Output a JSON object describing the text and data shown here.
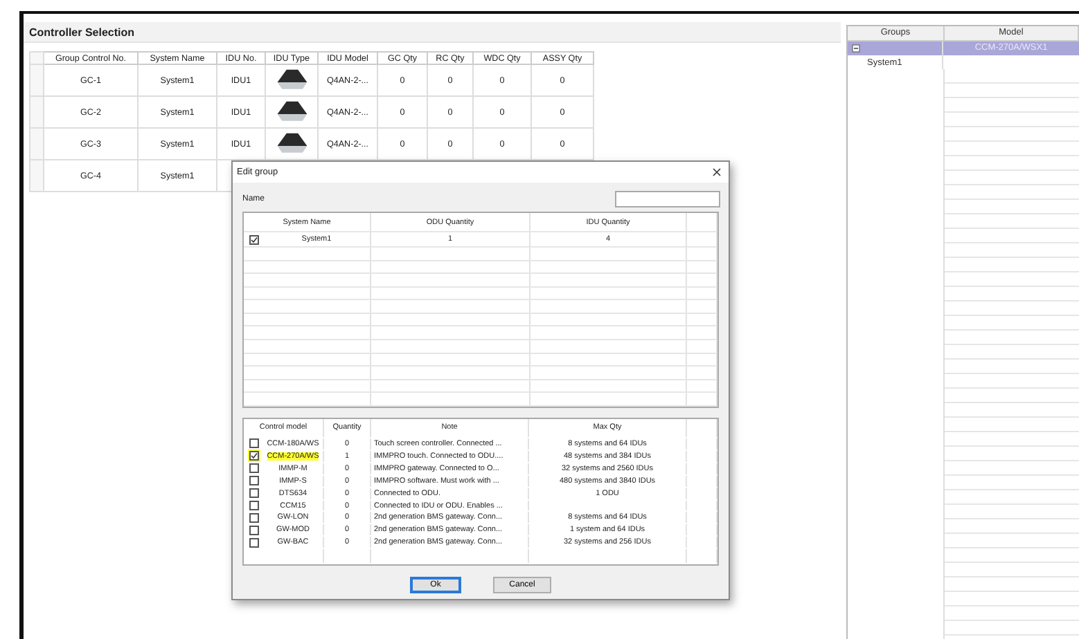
{
  "panel_title": "Controller Selection",
  "table": {
    "columns": [
      "Group Control No.",
      "System Name",
      "IDU No.",
      "IDU Type",
      "IDU Model",
      "GC Qty",
      "RC Qty",
      "WDC Qty",
      "ASSY Qty"
    ],
    "rows": [
      {
        "group_control_no": "GC-1",
        "system_name": "System1",
        "idu_no": "IDU1",
        "idu_model": "Q4AN-2-...",
        "gc_qty": "0",
        "rc_qty": "0",
        "wdc_qty": "0",
        "assy_qty": "0"
      },
      {
        "group_control_no": "GC-2",
        "system_name": "System1",
        "idu_no": "IDU1",
        "idu_model": "Q4AN-2-...",
        "gc_qty": "0",
        "rc_qty": "0",
        "wdc_qty": "0",
        "assy_qty": "0"
      },
      {
        "group_control_no": "GC-3",
        "system_name": "System1",
        "idu_no": "IDU1",
        "idu_model": "Q4AN-2-...",
        "gc_qty": "0",
        "rc_qty": "0",
        "wdc_qty": "0",
        "assy_qty": "0"
      },
      {
        "group_control_no": "GC-4",
        "system_name": "System1"
      }
    ]
  },
  "groups_panel": {
    "columns": [
      "Groups",
      "Model"
    ],
    "tree": [
      {
        "expanded": true,
        "selected": true,
        "model": "CCM-270A/WSX1",
        "children": [
          {
            "label": "System1"
          }
        ]
      }
    ]
  },
  "dialog": {
    "title": "Edit group",
    "name_label": "Name",
    "systems": {
      "columns": [
        "System Name",
        "ODU Quantity",
        "IDU Quantity"
      ],
      "rows": [
        {
          "checked": true,
          "system_name": "System1",
          "odu_quantity": "1",
          "idu_quantity": "4"
        }
      ]
    },
    "controls": {
      "columns": [
        "Control model",
        "Quantity",
        "Note",
        "Max Qty"
      ],
      "rows": [
        {
          "checked": false,
          "model": "CCM-180A/WS",
          "quantity": "0",
          "note": "Touch screen controller. Connected ...",
          "max_qty": "8 systems and 64 IDUs"
        },
        {
          "checked": true,
          "model": "CCM-270A/WS",
          "quantity": "1",
          "note": "IMMPRO touch. Connected to ODU....",
          "max_qty": "48 systems and 384 IDUs"
        },
        {
          "checked": false,
          "model": "IMMP-M",
          "quantity": "0",
          "note": "IMMPRO gateway. Connected to O...",
          "max_qty": "32 systems and 2560 IDUs"
        },
        {
          "checked": false,
          "model": "IMMP-S",
          "quantity": "0",
          "note": "IMMPRO software. Must work with ...",
          "max_qty": "480 systems and 3840 IDUs"
        },
        {
          "checked": false,
          "model": "DTS634",
          "quantity": "0",
          "note": "Connected to ODU.",
          "max_qty": "1 ODU"
        },
        {
          "checked": false,
          "model": "CCM15",
          "quantity": "0",
          "note": "Connected to IDU or ODU. Enables ..."
        },
        {
          "checked": false,
          "model": "GW-LON",
          "quantity": "0",
          "note": "2nd generation BMS gateway. Conn...",
          "max_qty": "8 systems and 64 IDUs"
        },
        {
          "checked": false,
          "model": "GW-MOD",
          "quantity": "0",
          "note": "2nd generation BMS gateway. Conn...",
          "max_qty": "1 system and 64 IDUs"
        },
        {
          "checked": false,
          "model": "GW-BAC",
          "quantity": "0",
          "note": "2nd generation BMS gateway. Conn...",
          "max_qty": "32 systems and 256 IDUs"
        }
      ]
    },
    "buttons": [
      {
        "label": "Ok",
        "default": true
      },
      {
        "label": "Cancel",
        "default": false
      }
    ]
  }
}
